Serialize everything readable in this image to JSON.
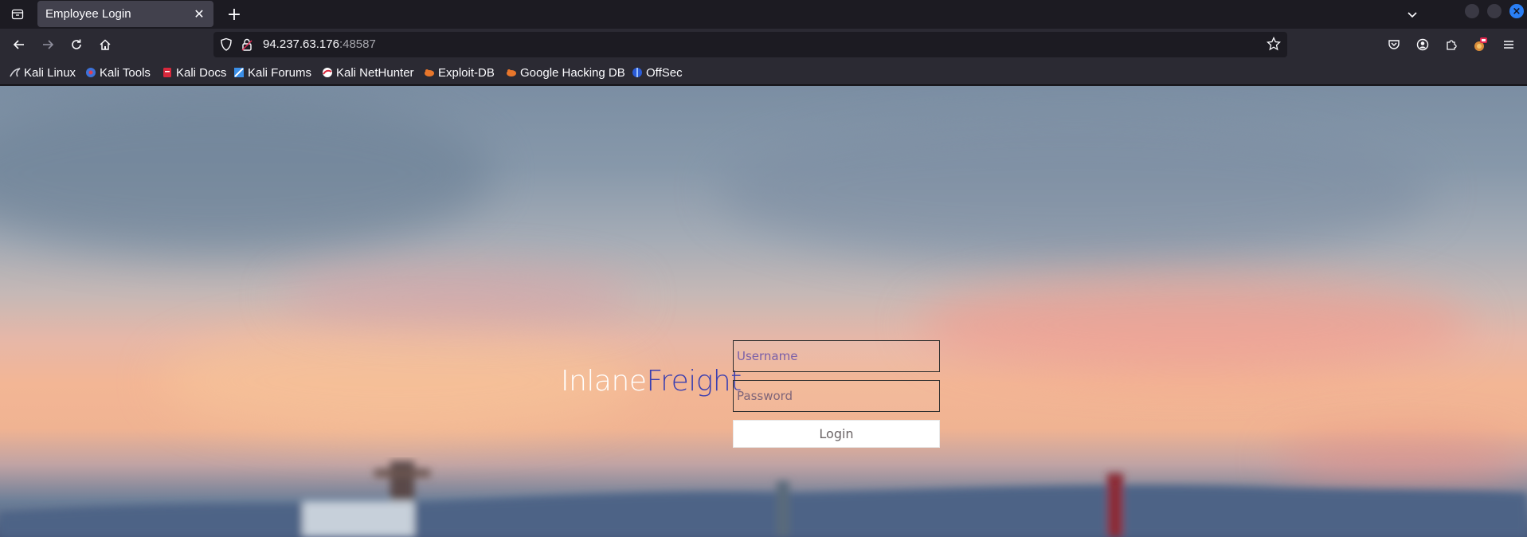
{
  "browser": {
    "tab": {
      "title": "Employee Login",
      "close_glyph": "✕"
    },
    "new_tab_glyph": "+",
    "url": {
      "host": "94.237.63.176",
      "port": ":48587"
    },
    "bookmarks": [
      {
        "label": "Kali Linux",
        "icon": "kali-dragon-icon"
      },
      {
        "label": "Kali Tools",
        "icon": "kali-tools-icon"
      },
      {
        "label": "Kali Docs",
        "icon": "kali-docs-icon"
      },
      {
        "label": "Kali Forums",
        "icon": "kali-forums-icon"
      },
      {
        "label": "Kali NetHunter",
        "icon": "nethunter-icon"
      },
      {
        "label": "Exploit-DB",
        "icon": "exploit-db-icon"
      },
      {
        "label": "Google Hacking DB",
        "icon": "ghdb-icon"
      },
      {
        "label": "OffSec",
        "icon": "offsec-icon"
      }
    ]
  },
  "login": {
    "brand_part1": "Inlane",
    "brand_part2": "Freight",
    "username_placeholder": "Username",
    "password_placeholder": "Password",
    "submit_label": "Login"
  },
  "colors": {
    "brand_light": "#ffffff",
    "brand_dark": "#3b3fb0",
    "chrome_dark": "#1c1b22",
    "chrome_mid": "#2b2a33",
    "accent": "#2a7ff5"
  }
}
